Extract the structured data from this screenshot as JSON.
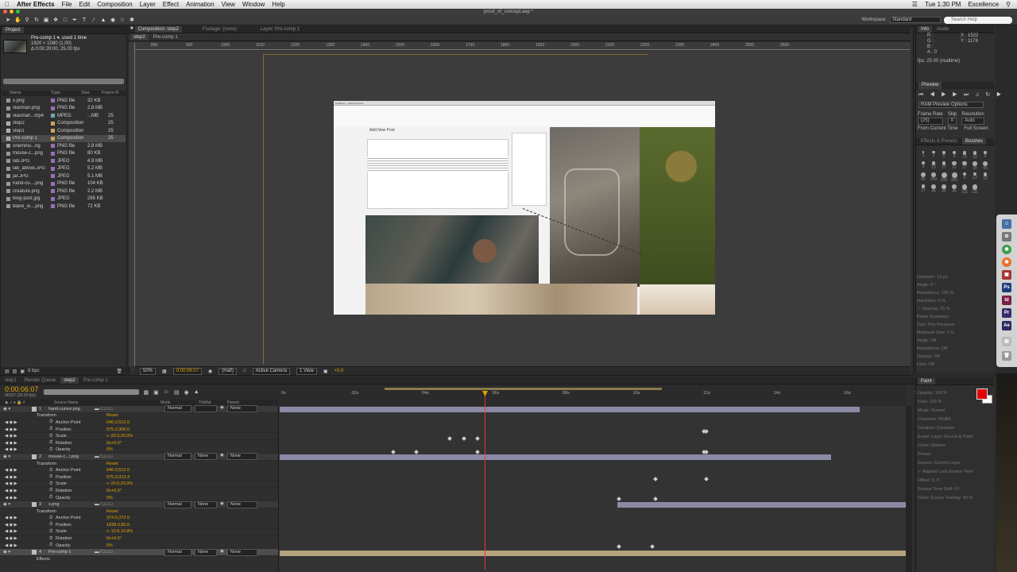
{
  "menubar": {
    "app": "After Effects",
    "items": [
      "File",
      "Edit",
      "Composition",
      "Layer",
      "Effect",
      "Animation",
      "View",
      "Window",
      "Help"
    ],
    "clock": "Tue 1:30 PM",
    "user": "Excellence"
  },
  "window": {
    "title": "proof_of_concept.aep *"
  },
  "toolbar": {
    "workspace_label": "Workspace:",
    "workspace_value": "Standard",
    "search_placeholder": "Search Help"
  },
  "project": {
    "tab": "Project",
    "selected_name": "Pre-comp 1 ▾, used 1 time",
    "selected_dims": "1920 × 1080 (1.00)",
    "selected_dur": "Δ 0:00:20:00, 25.00 fps",
    "columns": [
      "Name",
      "Type",
      "Size",
      "Frame R"
    ],
    "items": [
      {
        "name": "x.png",
        "type": "PNG file",
        "size": "32 KB",
        "fr": "",
        "color": "#9a6fb4",
        "comp": false
      },
      {
        "name": "vlasman.png",
        "type": "PNG file",
        "size": "2.8 MB",
        "fr": "",
        "color": "#9a6fb4",
        "comp": false
      },
      {
        "name": "vlasman...mp4",
        "type": "MPEG",
        "size": "...MB",
        "fr": "25",
        "color": "#6fa7b4",
        "comp": false
      },
      {
        "name": "step2",
        "type": "Composition",
        "size": "",
        "fr": "25",
        "color": "#c9a45a",
        "comp": true
      },
      {
        "name": "step1",
        "type": "Composition",
        "size": "",
        "fr": "25",
        "color": "#c9a45a",
        "comp": true
      },
      {
        "name": "Pre-comp 1",
        "type": "Composition",
        "size": "",
        "fr": "25",
        "color": "#c9a45a",
        "comp": true
      },
      {
        "name": "oneminu...ng",
        "type": "PNG file",
        "size": "2.8 MB",
        "fr": "",
        "color": "#9a6fb4",
        "comp": false
      },
      {
        "name": "mouse-c...png",
        "type": "PNG file",
        "size": "80 KB",
        "fr": "",
        "color": "#9a6fb4",
        "comp": false
      },
      {
        "name": "lab.JPG",
        "type": "JPEG",
        "size": "4.9 MB",
        "fr": "",
        "color": "#9a6fb4",
        "comp": false
      },
      {
        "name": "lab_above.JPG",
        "type": "JPEG",
        "size": "5.2 MB",
        "fr": "",
        "color": "#9a6fb4",
        "comp": false
      },
      {
        "name": "jar.JPG",
        "type": "JPEG",
        "size": "5.1 MB",
        "fr": "",
        "color": "#9a6fb4",
        "comp": false
      },
      {
        "name": "hand-cu....png",
        "type": "PNG file",
        "size": "104 KB",
        "fr": "",
        "color": "#9a6fb4",
        "comp": false
      },
      {
        "name": "creature.png",
        "type": "PNG file",
        "size": "2.2 MB",
        "fr": "",
        "color": "#9a6fb4",
        "comp": false
      },
      {
        "name": "blog-post.jpg",
        "type": "JPEG",
        "size": "285 KB",
        "fr": "",
        "color": "#9a6fb4",
        "comp": false
      },
      {
        "name": "blank_w....png",
        "type": "PNG file",
        "size": "72 KB",
        "fr": "",
        "color": "#9a6fb4",
        "comp": false
      }
    ],
    "bpc": "8 bpc"
  },
  "composition": {
    "tabs": [
      "Composition: step2",
      "Footage: (none)",
      "Layer: Pre-comp 1"
    ],
    "subtabs": [
      "step2",
      "Pre-comp 1"
    ],
    "ruler": [
      "800",
      "900",
      "1000",
      "1100",
      "1200",
      "1300",
      "1400",
      "1500",
      "1600",
      "1700",
      "1800",
      "1900",
      "2000",
      "2100",
      "2200",
      "2300",
      "2400",
      "2500",
      "2600"
    ],
    "wp_title": "Add New Post",
    "browser_url": "localhost — Add New Post",
    "zoom": "50%",
    "time": "0:00:06:07",
    "resolution": "(Half)",
    "camera": "Active Camera",
    "view": "1 View",
    "exposure": "+0.0"
  },
  "info": {
    "tabs": [
      "Info",
      "Audio"
    ],
    "r": "R :",
    "g": "G :",
    "b": "B :",
    "a": "A : 0",
    "x": "X : 1522",
    "y": "Y : 1178",
    "fps": "fps: 25.00 (realtime)"
  },
  "preview": {
    "tabs": [
      "Preview"
    ],
    "ram": "RAM Preview Options",
    "frame_rate_label": "Frame Rate",
    "frame_rate": "(25)",
    "skip_label": "Skip",
    "skip": "0",
    "resolution_label": "Resolution",
    "resolution": "Auto",
    "from_current": "From Current Time",
    "full_screen": "Full Screen"
  },
  "brushes": {
    "tabs": [
      "Effects & Presets",
      "Brushes"
    ],
    "sizes": [
      "1",
      "3",
      "5",
      "9",
      "13",
      "19",
      "5",
      "9",
      "13",
      "17",
      "21",
      "27",
      "35",
      "45",
      "65",
      "100",
      "200",
      "300",
      "9",
      "13",
      "19",
      "17",
      "45",
      "65",
      "45",
      "131",
      "131"
    ],
    "props": [
      "Diameter: 13 px",
      "Angle: 0 °",
      "Roundness: 100 %",
      "Hardness: 0 %",
      "✓ Spacing: 25 %",
      "Brush Dynamics",
      "Size: Pen Pressure",
      "Minimum Size: 1 %",
      "Angle: Off",
      "Roundness: Off",
      "Opacity: Off",
      "Flow: Off"
    ]
  },
  "timeline": {
    "tabs": [
      "step1",
      "Render Queue",
      "step2",
      "Pre-comp 1"
    ],
    "time": "0:00:06:07",
    "frames": "00157 (25.00 fps)",
    "columns": [
      "Source Name",
      "Mode",
      "TrkMat",
      "Parent"
    ],
    "ticks": [
      "0s",
      "02s",
      "04s",
      "06s",
      "08s",
      "10s",
      "12s",
      "14s",
      "16s",
      "18s"
    ],
    "rows": [
      {
        "kind": "layer",
        "num": "1",
        "name": "hand-cursor.png",
        "mode": "Normal",
        "trk": "",
        "parent": "None"
      },
      {
        "kind": "group",
        "name": "Transform",
        "val": "Reset"
      },
      {
        "kind": "prop",
        "name": "Anchor Point",
        "val": "640.0,512.0"
      },
      {
        "kind": "prop",
        "name": "Position",
        "val": "575.2,306.0"
      },
      {
        "kind": "prop",
        "name": "Scale",
        "val": "∞ 20.0,20.0%"
      },
      {
        "kind": "prop",
        "name": "Rotation",
        "val": "0x+0.0°"
      },
      {
        "kind": "prop",
        "name": "Opacity",
        "val": "0%"
      },
      {
        "kind": "layer",
        "num": "2",
        "name": "mouse-c...r.png",
        "mode": "Normal",
        "trk": "None",
        "parent": "None"
      },
      {
        "kind": "group",
        "name": "Transform",
        "val": "Reset"
      },
      {
        "kind": "prop",
        "name": "Anchor Point",
        "val": "640.0,512.0"
      },
      {
        "kind": "prop",
        "name": "Position",
        "val": "575.0,313.4"
      },
      {
        "kind": "prop",
        "name": "Scale",
        "val": "∞ 20.0,20.0%"
      },
      {
        "kind": "prop",
        "name": "Rotation",
        "val": "0x+0.0°"
      },
      {
        "kind": "prop",
        "name": "Opacity",
        "val": "0%"
      },
      {
        "kind": "layer",
        "num": "3",
        "name": "x.png",
        "mode": "Normal",
        "trk": "None",
        "parent": "None"
      },
      {
        "kind": "group",
        "name": "Transform",
        "val": "Reset"
      },
      {
        "kind": "prop",
        "name": "Anchor Point",
        "val": "374.5,372.5"
      },
      {
        "kind": "prop",
        "name": "Position",
        "val": "1838.0,80.0"
      },
      {
        "kind": "prop",
        "name": "Scale",
        "val": "∞ 10.8,10.8%"
      },
      {
        "kind": "prop",
        "name": "Rotation",
        "val": "0x+0.0°"
      },
      {
        "kind": "prop",
        "name": "Opacity",
        "val": "0%"
      },
      {
        "kind": "layer",
        "num": "4",
        "name": "Pre-comp 1",
        "mode": "Normal",
        "trk": "None",
        "parent": "None",
        "selected": true
      },
      {
        "kind": "group",
        "name": "Effects",
        "val": ""
      }
    ]
  },
  "paint": {
    "tab": "Paint",
    "props": [
      "Opacity: 100 %",
      "Flow: 100 %",
      "Mode: Normal",
      "Channels: RGBA",
      "Duration: Constant",
      "Erase: Layer Source & Paint",
      "Clone Options",
      "Preset:",
      "Source: Current Layer",
      "✓ Aligned   Lock Source Time",
      "Offset: 0, 0",
      "Source Time Shift: 0 f",
      "Clone Source Overlay: 50 %"
    ]
  }
}
